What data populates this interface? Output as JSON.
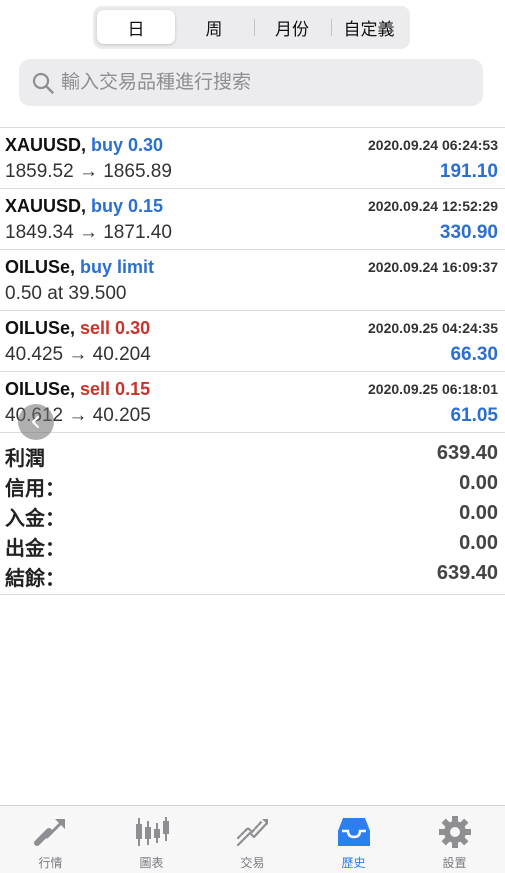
{
  "segments": [
    "日",
    "周",
    "月份",
    "自定義"
  ],
  "search": {
    "placeholder": "輸入交易品種進行搜索"
  },
  "orders": [
    {
      "symbol": "XAUUSD,",
      "side": "buy 0.30",
      "side_type": "buy",
      "time": "2020.09.24 06:24:53",
      "price": "1859.52 → 1865.89",
      "profit": "191.10"
    },
    {
      "symbol": "XAUUSD,",
      "side": "buy 0.15",
      "side_type": "buy",
      "time": "2020.09.24 12:52:29",
      "price": "1849.34 → 1871.40",
      "profit": "330.90"
    },
    {
      "symbol": "OILUSe,",
      "side": "buy limit",
      "side_type": "buy",
      "time": "2020.09.24 16:09:37",
      "price": "0.50 at 39.500",
      "profit": ""
    },
    {
      "symbol": "OILUSe,",
      "side": "sell 0.30",
      "side_type": "sell",
      "time": "2020.09.25 04:24:35",
      "price": "40.425 → 40.204",
      "profit": "66.30"
    },
    {
      "symbol": "OILUSe,",
      "side": "sell 0.15",
      "side_type": "sell",
      "time": "2020.09.25 06:18:01",
      "price": "40.612 → 40.205",
      "profit": "61.05"
    }
  ],
  "summary": [
    {
      "label": "利潤",
      "value": "639.40"
    },
    {
      "label": "信用：",
      "value": "0.00"
    },
    {
      "label": "入金：",
      "value": "0.00"
    },
    {
      "label": "出金：",
      "value": "0.00"
    },
    {
      "label": "結餘：",
      "value": "639.40"
    }
  ],
  "tabs": [
    {
      "label": "行情",
      "icon": "quotes-icon"
    },
    {
      "label": "圖表",
      "icon": "chart-icon"
    },
    {
      "label": "交易",
      "icon": "trade-icon"
    },
    {
      "label": "歷史",
      "icon": "history-icon"
    },
    {
      "label": "設置",
      "icon": "settings-icon"
    }
  ],
  "colors": {
    "accent": "#2b7ff0",
    "buy": "#2b6fd0",
    "sell": "#c9332c",
    "inactive_tab": "#8e8e93"
  }
}
